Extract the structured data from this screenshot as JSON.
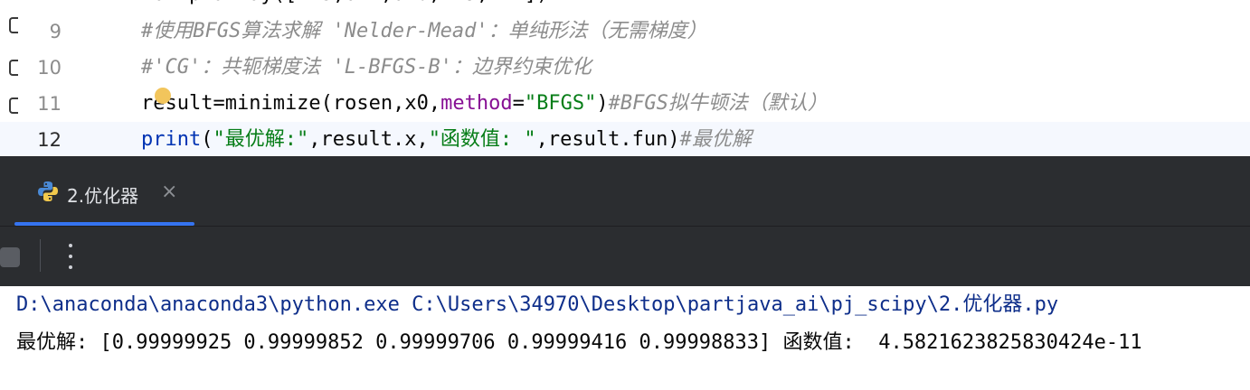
{
  "editor": {
    "lines": [
      {
        "number": "9",
        "comment": "#使用BFGS算法求解 'Nelder-Mead'：单纯形法（无需梯度）"
      },
      {
        "number": "10",
        "comment": "#'CG'：共轭梯度法 'L-BFGS-B'：边界约束优化"
      },
      {
        "number": "11",
        "code_a": "result=minimize(rosen,x0,",
        "kw": "method",
        "eq": "=",
        "str": "\"BFGS\"",
        "close": ")",
        "comment": "#BFGS拟牛顿法（默认）"
      },
      {
        "number": "12",
        "fn": "print",
        "open": "(",
        "str1": "\"最优解:\"",
        "mid": ",result.x,",
        "str2": "\"函数值: \"",
        "tail": ",result.fun)",
        "comment": "#最优解"
      }
    ]
  },
  "run_panel": {
    "tab_label": "2.优化器",
    "tab_close": "×"
  },
  "console": {
    "command": "D:\\anaconda\\anaconda3\\python.exe C:\\Users\\34970\\Desktop\\partjava_ai\\pj_scipy\\2.优化器.py",
    "output": "最优解: [0.99999925 0.99999852 0.99999706 0.99999416 0.99998833] 函数值:  4.5821623825830424e-11"
  },
  "colors": {
    "accent": "#3574f0",
    "comment": "#8c8c8c",
    "string": "#067d17",
    "keyword": "#871094",
    "builtin": "#0033b3",
    "panel_bg": "#2b2d30"
  },
  "icons": [
    "python-file-icon",
    "close-icon",
    "stop-icon",
    "more-options-icon",
    "intention-bulb-icon"
  ]
}
